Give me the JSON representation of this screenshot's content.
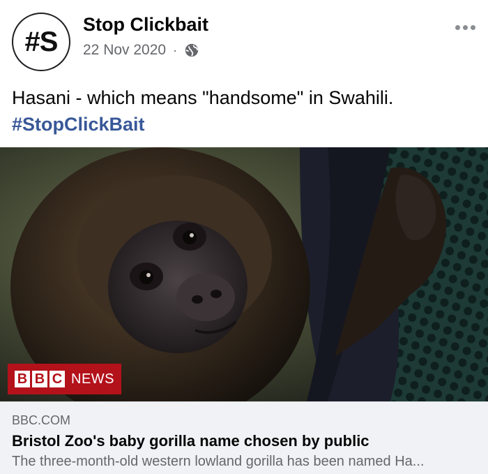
{
  "post": {
    "avatar_text": "#S",
    "page_name": "Stop Clickbait",
    "date": "22 Nov 2020",
    "separator": "·",
    "audience_icon": "globe-icon",
    "more_icon": "more-options-icon",
    "text": "Hasani - which means \"handsome\" in Swahili.",
    "hashtag": "#StopClickBait"
  },
  "image": {
    "logo_letters": [
      "B",
      "B",
      "C"
    ],
    "logo_word": "NEWS",
    "logo_color": "#b3121b"
  },
  "link_preview": {
    "domain": "BBC.COM",
    "title": "Bristol Zoo's baby gorilla name chosen by public",
    "description": "The three-month-old western lowland gorilla has been named Ha..."
  },
  "colors": {
    "hashtag": "#385898",
    "secondary_text": "#65676b",
    "preview_background": "#f0f2f5"
  }
}
